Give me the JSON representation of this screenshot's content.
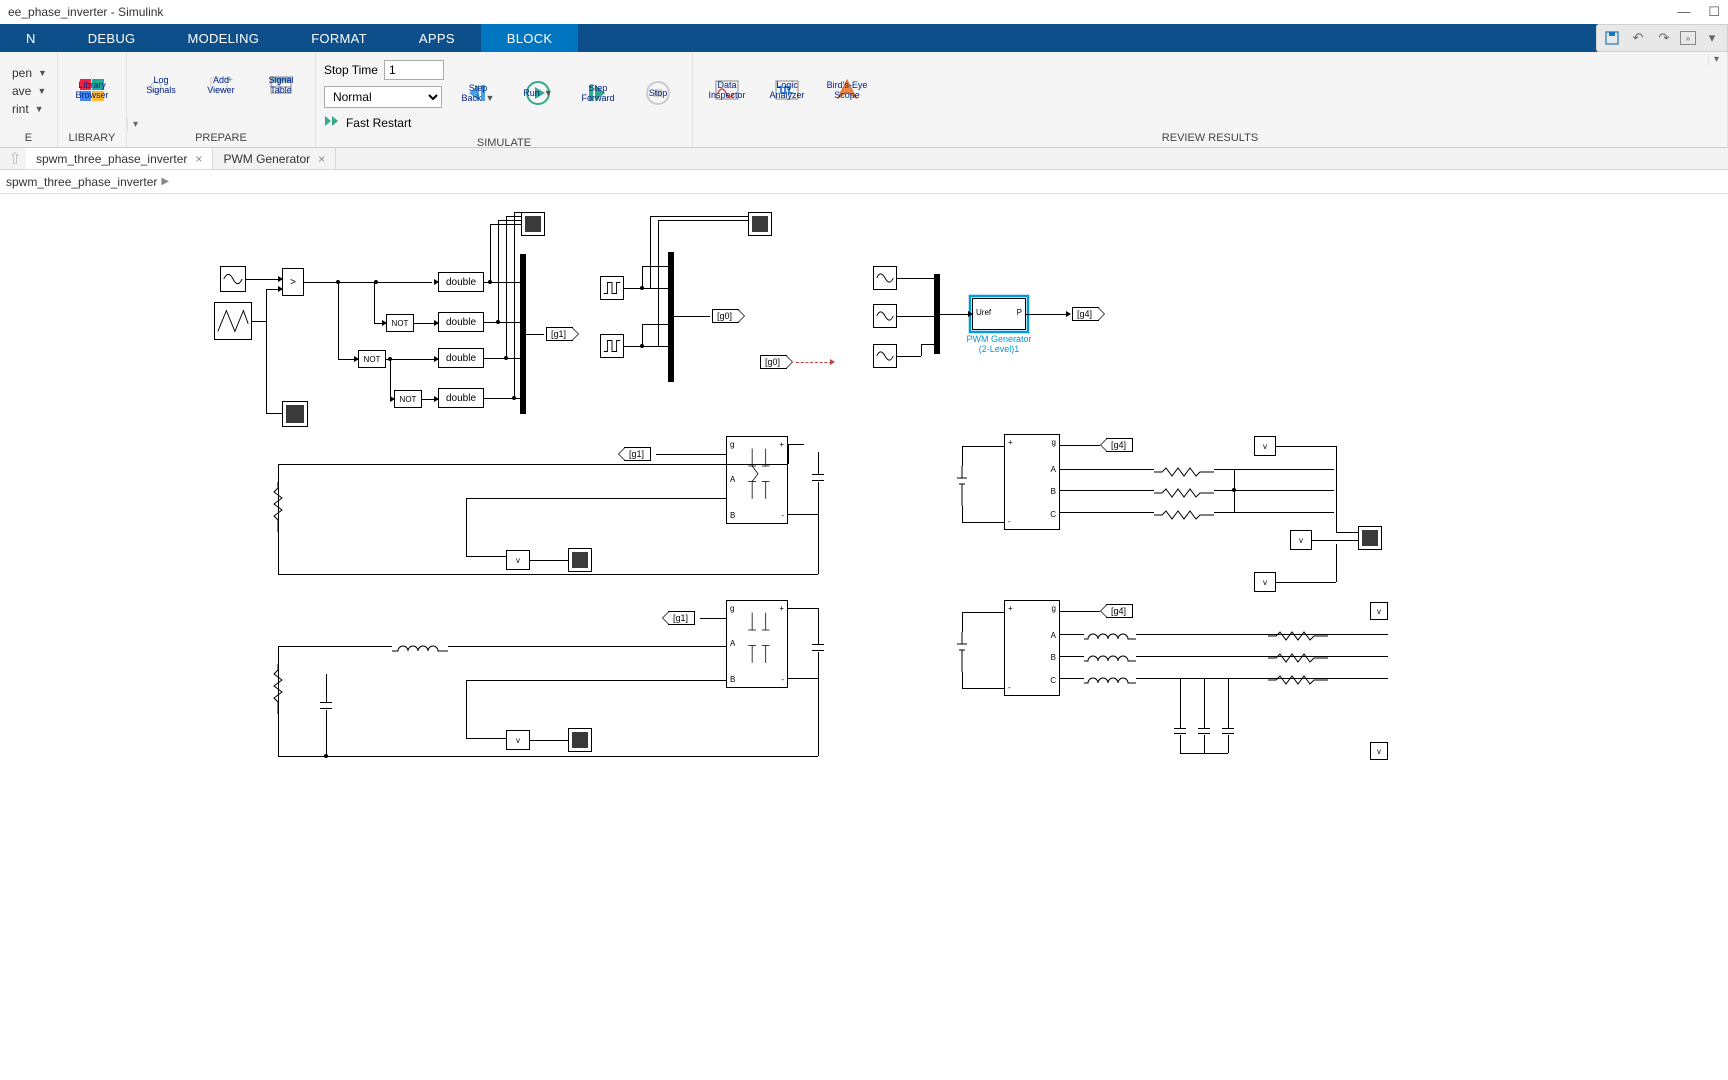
{
  "window": {
    "title": "ee_phase_inverter - Simulink",
    "min": "—",
    "max": "☐",
    "close": "✕"
  },
  "tabs": {
    "t0": "N",
    "t1": "DEBUG",
    "t2": "MODELING",
    "t3": "FORMAT",
    "t4": "APPS",
    "t5": "BLOCK"
  },
  "ribbon": {
    "file_open": "pen",
    "file_save": "ave",
    "file_print": "rint",
    "file_e": "E",
    "library_browser": "Library\nBrowser",
    "library_group": "LIBRARY",
    "log_signals": "Log\nSignals",
    "add_viewer": "Add\nViewer",
    "signal_table": "Signal\nTable",
    "prepare_group": "PREPARE",
    "stop_time_label": "Stop Time",
    "stop_time_value": "1",
    "mode": "Normal",
    "fast_restart": "Fast Restart",
    "step_back": "Step\nBack",
    "run": "Run",
    "step_forward": "Step\nForward",
    "stop": "Stop",
    "simulate_group": "SIMULATE",
    "data_inspector": "Data\nInspector",
    "logic_analyzer": "Logic\nAnalyzer",
    "birds_eye": "Bird's-Eye\nScope",
    "review_group": "REVIEW RESULTS"
  },
  "doctabs": {
    "t0": "spwm_three_phase_inverter",
    "t1": "PWM Generator"
  },
  "breadcrumb": {
    "root": "spwm_three_phase_inverter"
  },
  "blocks": {
    "gt": ">",
    "not": "NOT",
    "double": "double",
    "g0": "[g0]",
    "g1": "[g1]",
    "g4": "[g4]",
    "uref": "Uref",
    "p": "P",
    "pwm_name": "PWM Generator\n(2-Level)1",
    "g": "g",
    "A": "A",
    "B": "B",
    "C": "C",
    "plus": "+",
    "minus": "-",
    "v": "v"
  }
}
